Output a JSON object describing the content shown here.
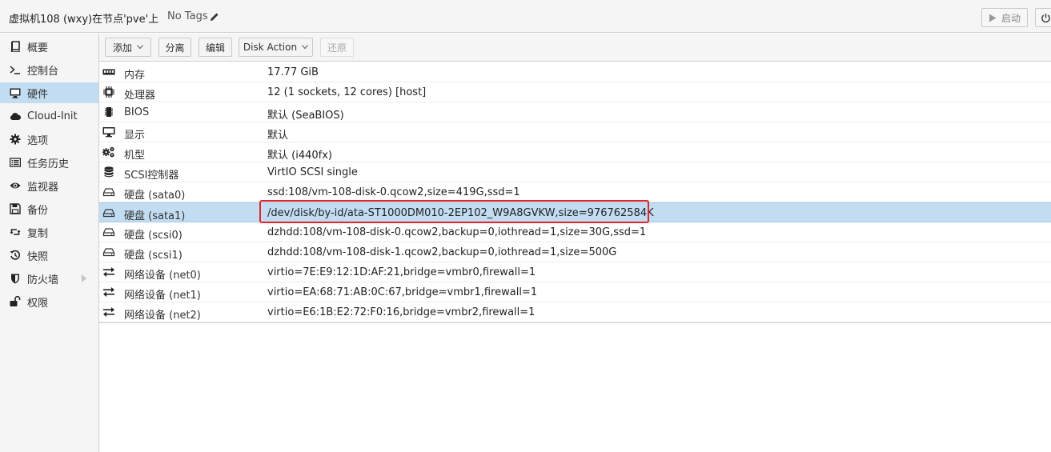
{
  "header": {
    "vm_title": "虚拟机108 (wxy)在节点'pve'上",
    "no_tags": "No Tags",
    "start_label": "启动"
  },
  "sidebar": {
    "items": [
      {
        "label": "概要",
        "icon": "book-icon"
      },
      {
        "label": "控制台",
        "icon": "terminal-icon"
      },
      {
        "label": "硬件",
        "icon": "desktop-icon",
        "active": true
      },
      {
        "label": "Cloud-Init",
        "icon": "cloud-icon"
      },
      {
        "label": "选项",
        "icon": "gear-icon"
      },
      {
        "label": "任务历史",
        "icon": "list-icon"
      },
      {
        "label": "监视器",
        "icon": "eye-icon"
      },
      {
        "label": "备份",
        "icon": "floppy-icon"
      },
      {
        "label": "复制",
        "icon": "retweet-icon"
      },
      {
        "label": "快照",
        "icon": "history-icon"
      },
      {
        "label": "防火墙",
        "icon": "shield-icon",
        "has_submenu": true
      },
      {
        "label": "权限",
        "icon": "unlock-icon"
      }
    ]
  },
  "toolbar": {
    "add_label": "添加",
    "detach_label": "分离",
    "edit_label": "编辑",
    "disk_action_label": "Disk Action",
    "revert_label": "还原"
  },
  "hardware": {
    "rows": [
      {
        "icon": "memory-icon",
        "label": "内存",
        "value": "17.77 GiB"
      },
      {
        "icon": "cpu-icon",
        "label": "处理器",
        "value": "12 (1 sockets, 12 cores) [host]"
      },
      {
        "icon": "chip-icon",
        "label": "BIOS",
        "value": "默认 (SeaBIOS)"
      },
      {
        "icon": "desktop-icon",
        "label": "显示",
        "value": "默认"
      },
      {
        "icon": "cogs-icon",
        "label": "机型",
        "value": "默认 (i440fx)"
      },
      {
        "icon": "database-icon",
        "label": "SCSI控制器",
        "value": "VirtIO SCSI single"
      },
      {
        "icon": "hdd-icon",
        "label": "硬盘 (sata0)",
        "value": "ssd:108/vm-108-disk-0.qcow2,size=419G,ssd=1"
      },
      {
        "icon": "hdd-icon",
        "label": "硬盘 (sata1)",
        "value": "/dev/disk/by-id/ata-ST1000DM010-2EP102_W9A8GVKW,size=976762584K",
        "selected": true
      },
      {
        "icon": "hdd-icon",
        "label": "硬盘 (scsi0)",
        "value": "dzhdd:108/vm-108-disk-0.qcow2,backup=0,iothread=1,size=30G,ssd=1"
      },
      {
        "icon": "hdd-icon",
        "label": "硬盘 (scsi1)",
        "value": "dzhdd:108/vm-108-disk-1.qcow2,backup=0,iothread=1,size=500G"
      },
      {
        "icon": "exchange-icon",
        "label": "网络设备 (net0)",
        "value": "virtio=7E:E9:12:1D:AF:21,bridge=vmbr0,firewall=1"
      },
      {
        "icon": "exchange-icon",
        "label": "网络设备 (net1)",
        "value": "virtio=EA:68:71:AB:0C:67,bridge=vmbr1,firewall=1"
      },
      {
        "icon": "exchange-icon",
        "label": "网络设备 (net2)",
        "value": "virtio=E6:1B:E2:72:F0:16,bridge=vmbr2,firewall=1"
      }
    ]
  },
  "colors": {
    "selection": "#c2ddf2",
    "highlight_box": "#e0242a"
  }
}
